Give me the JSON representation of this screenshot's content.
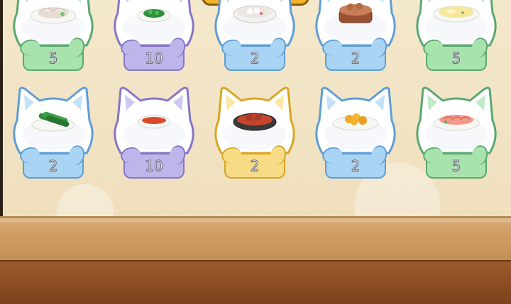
{
  "top_button": {
    "color": "#f2b52a"
  },
  "colors": {
    "green": {
      "fill": "#a8e3ae",
      "stroke": "#5aa872",
      "ear": "#bfe9c7"
    },
    "purple": {
      "fill": "#bdb6ea",
      "stroke": "#8775c6",
      "ear": "#cfc8f2"
    },
    "blue": {
      "fill": "#a9d4f3",
      "stroke": "#5f9ed6",
      "ear": "#c3e1f7"
    },
    "yellow": {
      "fill": "#f8dc85",
      "stroke": "#d9a524",
      "ear": "#fbe6a6"
    }
  },
  "cards": [
    {
      "count": "5",
      "color": "green",
      "dish": "sliced-meat-plate-icon"
    },
    {
      "count": "10",
      "color": "purple",
      "dish": "green-vegetable-plate-icon"
    },
    {
      "count": "2",
      "color": "blue",
      "dish": "tangyuan-bowl-icon"
    },
    {
      "count": "2",
      "color": "blue",
      "dish": "steamer-dumplings-icon"
    },
    {
      "count": "5",
      "color": "green",
      "dish": "egg-plate-icon"
    },
    {
      "count": "2",
      "color": "blue",
      "dish": "cucumber-plate-icon"
    },
    {
      "count": "10",
      "color": "purple",
      "dish": "chili-sauce-dish-icon"
    },
    {
      "count": "2",
      "color": "yellow",
      "dish": "meatball-stew-bowl-icon"
    },
    {
      "count": "2",
      "color": "blue",
      "dish": "fried-food-plate-icon"
    },
    {
      "count": "5",
      "color": "green",
      "dish": "shrimp-plate-icon"
    }
  ]
}
